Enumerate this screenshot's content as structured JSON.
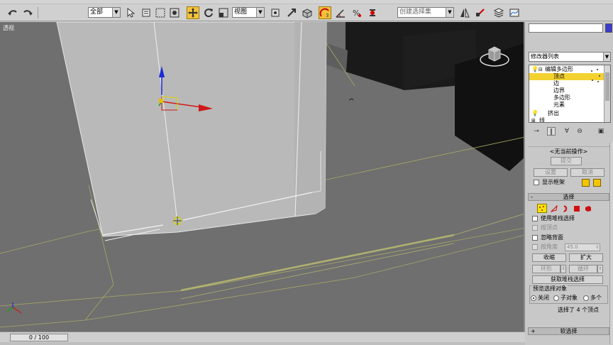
{
  "toolbar": {
    "filter_label": "全部",
    "viewport_label": "视图",
    "selection_set_placeholder": "创建选择集",
    "icons": [
      "undo-icon",
      "redo-icon",
      "select-icon",
      "rect-select-icon",
      "window-crossing-icon",
      "move-icon",
      "rotate-icon",
      "scale-icon",
      "manipulate-icon",
      "keyboard-shortcut-icon",
      "snap-icon",
      "angle-snap-icon",
      "percent-snap-icon",
      "spinner-snap-icon",
      "named-selection-icon",
      "mirror-icon",
      "align-icon",
      "layers-icon"
    ]
  },
  "viewport": {
    "label": "透视"
  },
  "timeline": {
    "frame_display": "0 / 100"
  },
  "panel": {
    "modifier_list_label": "修改器列表",
    "stack": [
      {
        "label": "编辑多边形",
        "level": 0,
        "selected": false
      },
      {
        "label": "顶点",
        "level": 1,
        "selected": true
      },
      {
        "label": "边",
        "level": 1,
        "selected": false
      },
      {
        "label": "边界",
        "level": 1,
        "selected": false
      },
      {
        "label": "多边形",
        "level": 1,
        "selected": false
      },
      {
        "label": "元素",
        "level": 1,
        "selected": false
      },
      {
        "label": "挤出",
        "level": 0,
        "selected": false
      },
      {
        "label": "线",
        "level": 0,
        "selected": false
      }
    ],
    "stack_tools": [
      "pin-stack-icon",
      "show-end-result-icon",
      "make-unique-icon",
      "remove-modifier-icon",
      "configure-sets-icon"
    ],
    "operation_title": "<无当前操作>",
    "commit_label": "提交",
    "settings_label": "设置",
    "cancel_label": "取消",
    "show_cage_label": "显示框架",
    "selection_title": "选择",
    "subobject_icons": [
      "vertex-icon",
      "edge-icon",
      "border-icon",
      "polygon-icon",
      "element-icon"
    ],
    "use_stack_selection_label": "使用堆栈选择",
    "by_vertex_label": "按顶点",
    "ignore_backfacing_label": "忽略背面",
    "by_angle_label": "按角度",
    "by_angle_value": "45.0",
    "shrink_label": "收缩",
    "grow_label": "扩大",
    "ring_label": "环形",
    "loop_label": "循环",
    "get_stack_selection_label": "获取堆栈选择",
    "preview_title": "预览选择对象",
    "preview_options": [
      "关闭",
      "子对象",
      "多个"
    ],
    "preview_selected": 0,
    "selection_status": "选择了 4 个顶点",
    "soft_selection_title": "软选择"
  }
}
